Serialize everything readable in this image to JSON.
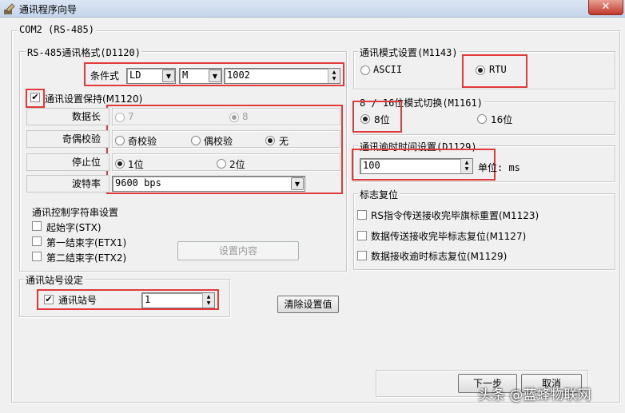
{
  "window": {
    "title": "通讯程序向导",
    "close_glyph": "✕"
  },
  "com_group": {
    "label": "COM2 (RS-485)"
  },
  "rs485": {
    "label": "RS-485通讯格式(D1120)",
    "condition_label": "条件式",
    "cond_select1": "LD",
    "cond_select2": "M",
    "cond_value": "1002",
    "keep_label": "通讯设置保持(M1120)",
    "keep_checked": true,
    "data_length": {
      "label": "数据长",
      "options": [
        "7",
        "8"
      ],
      "selected": "8",
      "disabled": true
    },
    "parity": {
      "label": "奇偶校验",
      "options": [
        "奇校验",
        "偶校验",
        "无"
      ],
      "selected": "无"
    },
    "stop_bit": {
      "label": "停止位",
      "options": [
        "1位",
        "2位"
      ],
      "selected": "1位"
    },
    "baud": {
      "label": "波特率",
      "value": "9600 bps"
    }
  },
  "ctrl_chars": {
    "label": "通讯控制字符串设置",
    "items": [
      "起始字(STX)",
      "第一结束字(ETX1)",
      "第二结束字(ETX2)"
    ],
    "button": "设置内容"
  },
  "station": {
    "label": "通讯站号设定",
    "checkbox_label": "通讯站号",
    "checked": true,
    "value": "1"
  },
  "clear_button": "清除设置值",
  "mode": {
    "label": "通讯模式设置(M1143)",
    "options": [
      "ASCII",
      "RTU"
    ],
    "selected": "RTU"
  },
  "bits": {
    "label": "8 / 16位模式切换(M1161)",
    "options": [
      "8位",
      "16位"
    ],
    "selected": "8位"
  },
  "timeout": {
    "label": "通讯逾时时间设置(D1129)",
    "value": "100",
    "unit": "单位: ms"
  },
  "flag_reset": {
    "label": "标志复位",
    "items": [
      "RS指令传送接收完毕旗标重置(M1123)",
      "数据传送接收完毕标志复位(M1127)",
      "数据接收逾时标志复位(M1129)"
    ]
  },
  "footer": {
    "next": "下一步",
    "cancel": "取消"
  },
  "watermark": "头条 @蓝蜂物联网"
}
